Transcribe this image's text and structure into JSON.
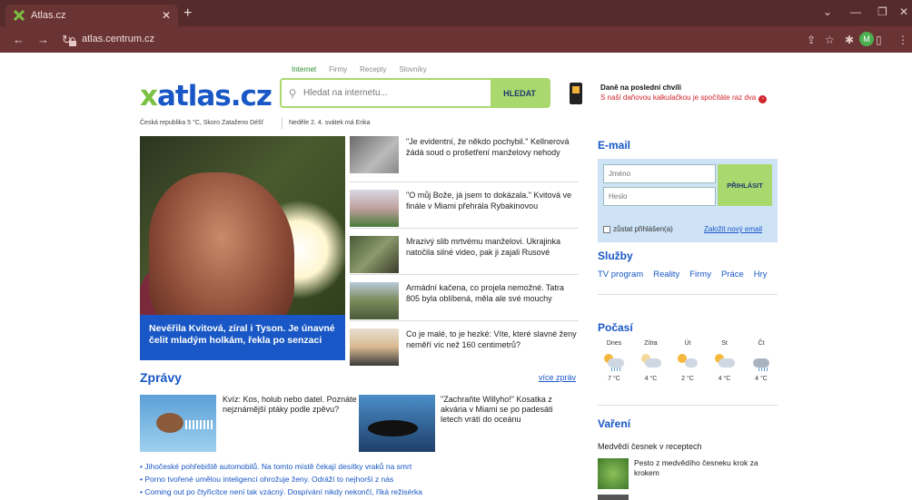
{
  "browser": {
    "tab_title": "Atlas.cz",
    "url": "atlas.centrum.cz",
    "avatar_letter": "M"
  },
  "search": {
    "tabs": [
      "Internet",
      "Firmy",
      "Recepty",
      "Slovníky"
    ],
    "placeholder": "Hledat na internetu...",
    "button": "HLEDAT"
  },
  "logo": {
    "x": "x",
    "text": "atlas.cz"
  },
  "promo": {
    "title": "Daně na poslední chvíli",
    "text": "S naší daňovou kalkulačkou je spočítáte raz dva"
  },
  "info": {
    "weather": "Česká republika 5 °C, Skoro Zataženo Déšť",
    "date": "Neděle 2. 4. svátek má Erika"
  },
  "hero": {
    "caption": "Nevěřila Kvitová, zíral i Tyson. Je únavné čelit mladým holkám, řekla po senzaci"
  },
  "news": [
    {
      "text": "\"Je evidentní, že někdo pochybil.\" Kellnerová žádá soud o prošetření manželovy nehody"
    },
    {
      "text": "\"O můj Bože, já jsem to dokázala.\" Kvitová ve finále v Miami přehrála Rybakinovou"
    },
    {
      "text": "Mrazivý slib mrtvému manželovi. Ukrajinka natočila silné video, pak ji zajali Rusové"
    },
    {
      "text": "Armádní kačena, co projela nemožné. Tatra 805 byla oblíbená, měla ale své mouchy"
    },
    {
      "text": "Co je malé, to je hezké: Víte, které slavné ženy neměří víc než 160 centimetrů?"
    }
  ],
  "zpravy": {
    "title": "Zprávy",
    "more": "více zpráv",
    "item1": "Kvíz: Kos, holub nebo datel. Poznáte nejznámější ptáky podle zpěvu?",
    "item2": "\"Zachraňte Willyho!\" Kosatka z akvária v Miami se po padesáti letech vrátí do oceánu",
    "bullets": [
      "Jihočeské pohřebiště automobilů. Na tomto místě čekají desítky vraků na smrt",
      "Porno tvořené umělou inteligencí ohrožuje ženy. Odráží to nejhorší z nás",
      "Coming out po čtyřicítce není tak vzácný. Dospívání nikdy nekončí, říká režisérka"
    ]
  },
  "email": {
    "title": "E-mail",
    "name_placeholder": "Jméno",
    "pass_placeholder": "Heslo",
    "login": "PŘIHLÁSIT",
    "remember": "zůstat přihlášen(a)",
    "new_account": "Založit nový email"
  },
  "sluzby": {
    "title": "Služby",
    "items": [
      "TV program",
      "Reality",
      "Firmy",
      "Práce",
      "Hry"
    ]
  },
  "pocasi": {
    "title": "Počasí",
    "days": [
      {
        "day": "Dnes",
        "temp": "7 °C"
      },
      {
        "day": "Zítra",
        "temp": "4 °C"
      },
      {
        "day": "Út",
        "temp": "2 °C"
      },
      {
        "day": "St",
        "temp": "4 °C"
      },
      {
        "day": "Čt",
        "temp": "4 °C"
      }
    ]
  },
  "vareni": {
    "title": "Vaření",
    "subtitle": "Medvědí česnek v receptech",
    "item": "Pesto z medvědího česneku krok za krokem"
  }
}
